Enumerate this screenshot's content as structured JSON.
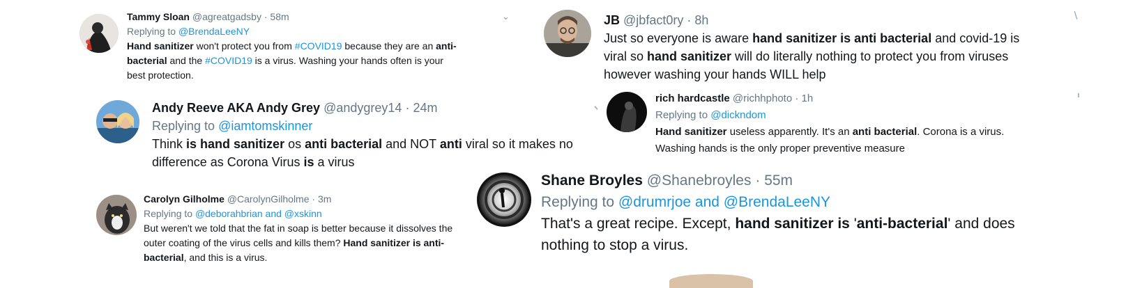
{
  "colors": {
    "link": "#1b95e0",
    "meta": "#657786",
    "text": "#14171a"
  },
  "tweets": [
    {
      "name": "Tammy Sloan",
      "handle": "@agreatgadsby",
      "time": "58m",
      "replying_prefix": "Replying to ",
      "replying_to": "@BrendaLeeNY",
      "lines": [
        [
          {
            "t": "Hand sanitizer",
            "b": true
          },
          {
            "t": " won't protect you from "
          },
          {
            "t": "#COVID19",
            "l": true
          },
          {
            "t": " because they are an "
          },
          {
            "t": "anti-",
            "b": true
          }
        ],
        [
          {
            "t": "bacterial",
            "b": true
          },
          {
            "t": " and the "
          },
          {
            "t": "#COVID19",
            "l": true
          },
          {
            "t": " is a virus. Washing your hands often is your"
          }
        ],
        [
          {
            "t": "best protection."
          }
        ]
      ]
    },
    {
      "name": "JB",
      "handle": "@jbfact0ry",
      "time": "8h",
      "lines": [
        [
          {
            "t": "Just so everyone is aware "
          },
          {
            "t": "hand sanitizer is anti bacterial",
            "b": true
          },
          {
            "t": " and covid-19 is"
          }
        ],
        [
          {
            "t": "viral so "
          },
          {
            "t": "hand sanitizer",
            "b": true
          },
          {
            "t": " will do literally nothing to protect you from viruses"
          }
        ],
        [
          {
            "t": "however washing your hands WILL help"
          }
        ]
      ]
    },
    {
      "name": "Andy Reeve AKA Andy Grey",
      "handle": "@andygrey14",
      "time": "24m",
      "replying_prefix": "Replying to ",
      "replying_to": "@iamtomskinner",
      "lines": [
        [
          {
            "t": "Think "
          },
          {
            "t": "is hand sanitizer",
            "b": true
          },
          {
            "t": " os "
          },
          {
            "t": "anti bacterial",
            "b": true
          },
          {
            "t": " and NOT "
          },
          {
            "t": "anti",
            "b": true
          },
          {
            "t": " viral so it makes no"
          }
        ],
        [
          {
            "t": "difference as Corona Virus "
          },
          {
            "t": "is",
            "b": true
          },
          {
            "t": " a virus"
          }
        ]
      ]
    },
    {
      "name": "rich hardcastle",
      "handle": "@richhphoto",
      "time": "1h",
      "replying_prefix": "Replying to ",
      "replying_to": "@dickndom",
      "lines": [
        [
          {
            "t": "Hand sanitizer",
            "b": true
          },
          {
            "t": " useless apparently. It's an "
          },
          {
            "t": "anti bacterial",
            "b": true
          },
          {
            "t": ". Corona is a virus."
          }
        ],
        [
          {
            "t": "Washing hands is the only proper preventive measure"
          }
        ]
      ]
    },
    {
      "name": "Shane Broyles",
      "handle": "@Shanebroyles",
      "time": "55m",
      "replying_prefix": "Replying to ",
      "replying_to": "@drumrjoe and @BrendaLeeNY",
      "lines": [
        [
          {
            "t": "That's a great recipe. Except, "
          },
          {
            "t": "hand sanitizer is",
            "b": true
          },
          {
            "t": " '"
          },
          {
            "t": "anti-bacterial",
            "b": true
          },
          {
            "t": "' and does"
          }
        ],
        [
          {
            "t": "nothing to stop a virus."
          }
        ]
      ]
    },
    {
      "name": "Carolyn Gilholme",
      "handle": "@CarolynGilholme",
      "time": "3m",
      "replying_prefix": "Replying to ",
      "replying_to": "@deborahbrian and @xskinn",
      "lines": [
        [
          {
            "t": "But weren't we told that the fat in soap is better because it dissolves the"
          }
        ],
        [
          {
            "t": "outer coating of the virus cells and kills them? "
          },
          {
            "t": "Hand sanitizer is anti-",
            "b": true
          }
        ],
        [
          {
            "t": "bacterial",
            "b": true
          },
          {
            "t": ", and this is a virus."
          }
        ]
      ]
    }
  ]
}
